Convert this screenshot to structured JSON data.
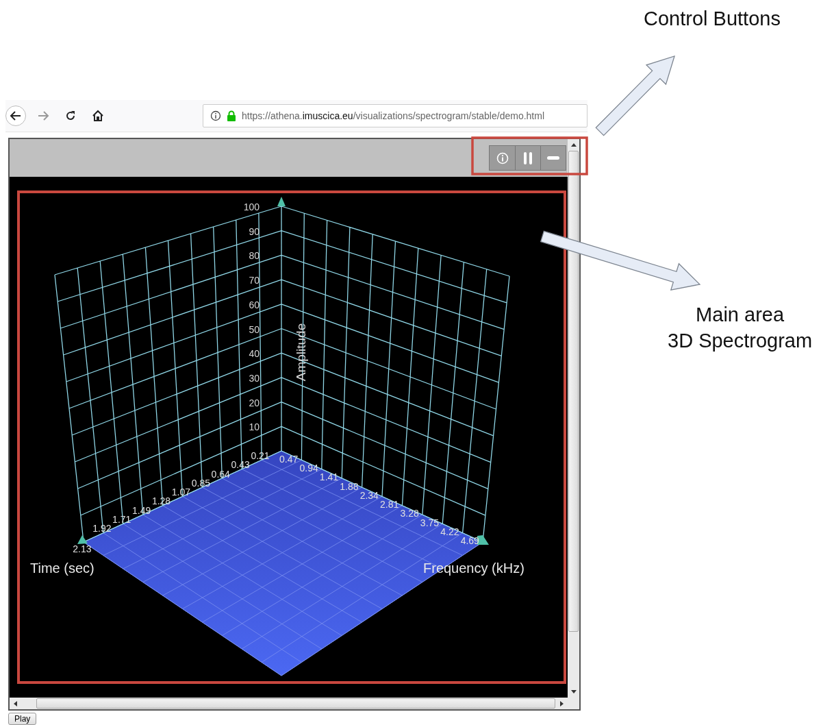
{
  "browser": {
    "url_prefix": "https://athena.",
    "url_domain": "imuscica.eu",
    "url_path": "/visualizations/spectrogram/stable/demo.html"
  },
  "toolbar": {
    "buttons": [
      {
        "kind": "info"
      },
      {
        "kind": "pause"
      },
      {
        "kind": "minimize"
      }
    ]
  },
  "spectrogram": {
    "amplitude_title": "Amplitude",
    "amplitude_ticks": [
      "100",
      "90",
      "80",
      "70",
      "60",
      "50",
      "40",
      "30",
      "20",
      "10"
    ],
    "time_ticks": [
      "0.21",
      "0.43",
      "0.64",
      "0.85",
      "1.07",
      "1.28",
      "1.49",
      "1.71",
      "1.92",
      "2.13"
    ],
    "time_title": "Time (sec)",
    "frequency_ticks": [
      "0.47",
      "0.94",
      "1.41",
      "1.88",
      "2.34",
      "2.81",
      "3.28",
      "3.75",
      "4.22",
      "4.69"
    ],
    "frequency_title": "Frequency (kHz)"
  },
  "play_button": "Play",
  "annotations": [
    {
      "lines": [
        "Control Buttons"
      ]
    },
    {
      "lines": [
        "Main area",
        "3D Spectrogram"
      ]
    }
  ]
}
